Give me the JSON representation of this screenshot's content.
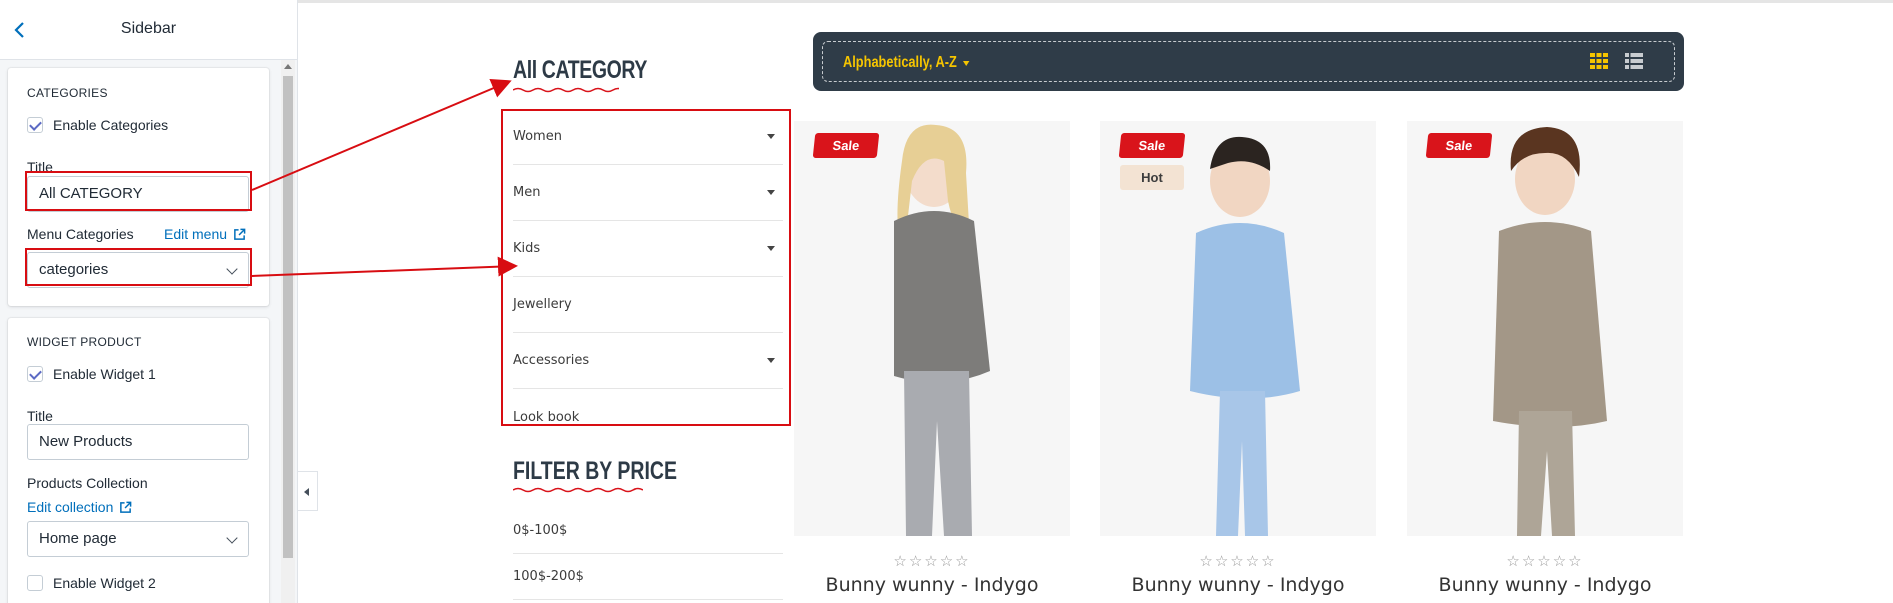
{
  "editor": {
    "title": "Sidebar",
    "categories_card": {
      "heading": "CATEGORIES",
      "enable_label": "Enable Categories",
      "enable_checked": true,
      "title_label": "Title",
      "title_value": "All CATEGORY",
      "menu_label": "Menu Categories",
      "edit_menu_link": "Edit menu",
      "menu_value": "categories"
    },
    "widget_card": {
      "heading": "WIDGET PRODUCT",
      "enable1_label": "Enable Widget 1",
      "enable1_checked": true,
      "title_label": "Title",
      "title_value": "New Products",
      "collection_label": "Products Collection",
      "edit_collection_link": "Edit collection",
      "collection_value": "Home page",
      "enable2_label": "Enable Widget 2",
      "enable2_checked": false
    }
  },
  "preview": {
    "category_title": "All CATEGORY",
    "categories": [
      {
        "label": "Women",
        "has_dropdown": true
      },
      {
        "label": "Men",
        "has_dropdown": true
      },
      {
        "label": "Kids",
        "has_dropdown": true
      },
      {
        "label": "Jewellery",
        "has_dropdown": false
      },
      {
        "label": "Accessories",
        "has_dropdown": true
      },
      {
        "label": "Look book",
        "has_dropdown": false
      }
    ],
    "filter_title": "FILTER BY PRICE",
    "prices": [
      "0$-100$",
      "100$-200$"
    ],
    "sort_label": "Alphabetically, A-Z",
    "products": [
      {
        "name": "Bunny wunny - Indygo",
        "sale": "Sale",
        "hot": null,
        "stars": "☆☆☆☆☆"
      },
      {
        "name": "Bunny wunny - Indygo",
        "sale": "Sale",
        "hot": "Hot",
        "stars": "☆☆☆☆☆"
      },
      {
        "name": "Bunny wunny - Indygo",
        "sale": "Sale",
        "hot": null,
        "stars": "☆☆☆☆☆"
      }
    ]
  },
  "colors": {
    "accent_red": "#d80d12",
    "link_blue": "#006fbb",
    "toolbar_bg": "#2f3c48",
    "sort_yellow": "#f6c500"
  }
}
